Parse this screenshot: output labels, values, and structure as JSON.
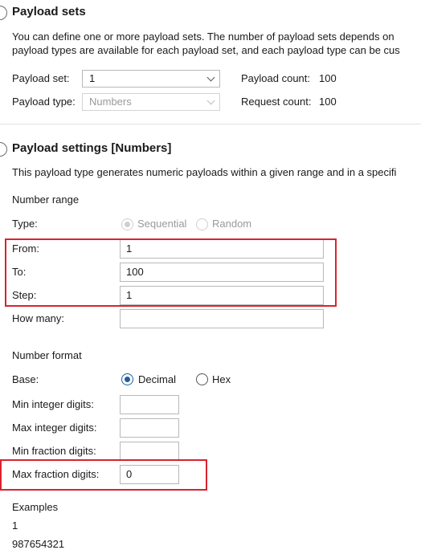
{
  "payload_sets": {
    "heading": "Payload sets",
    "desc_line1": "You can define one or more payload sets. The number of payload sets depends on",
    "desc_line2": "payload types are available for each payload set, and each payload type can be cus",
    "set_label": "Payload set:",
    "set_value": "1",
    "type_label": "Payload type:",
    "type_value": "Numbers",
    "count_label": "Payload count:",
    "count_value": "100",
    "request_label": "Request count:",
    "request_value": "100"
  },
  "payload_settings": {
    "heading": "Payload settings [Numbers]",
    "desc": "This payload type generates numeric payloads within a given range and in a specifi",
    "number_range": {
      "title": "Number range",
      "type_label": "Type:",
      "sequential_label": "Sequential",
      "random_label": "Random",
      "from_label": "From:",
      "from_value": "1",
      "to_label": "To:",
      "to_value": "100",
      "step_label": "Step:",
      "step_value": "1",
      "howmany_label": "How many:",
      "howmany_value": ""
    },
    "number_format": {
      "title": "Number format",
      "base_label": "Base:",
      "decimal_label": "Decimal",
      "hex_label": "Hex",
      "min_int_label": "Min integer digits:",
      "min_int_value": "",
      "max_int_label": "Max integer digits:",
      "max_int_value": "",
      "min_frac_label": "Min fraction digits:",
      "min_frac_value": "",
      "max_frac_label": "Max fraction digits:",
      "max_frac_value": "0"
    },
    "examples": {
      "title": "Examples",
      "line1": "1",
      "line2": "987654321"
    }
  },
  "colors": {
    "highlight": "#d9232e",
    "accent": "#1f5f9e"
  }
}
